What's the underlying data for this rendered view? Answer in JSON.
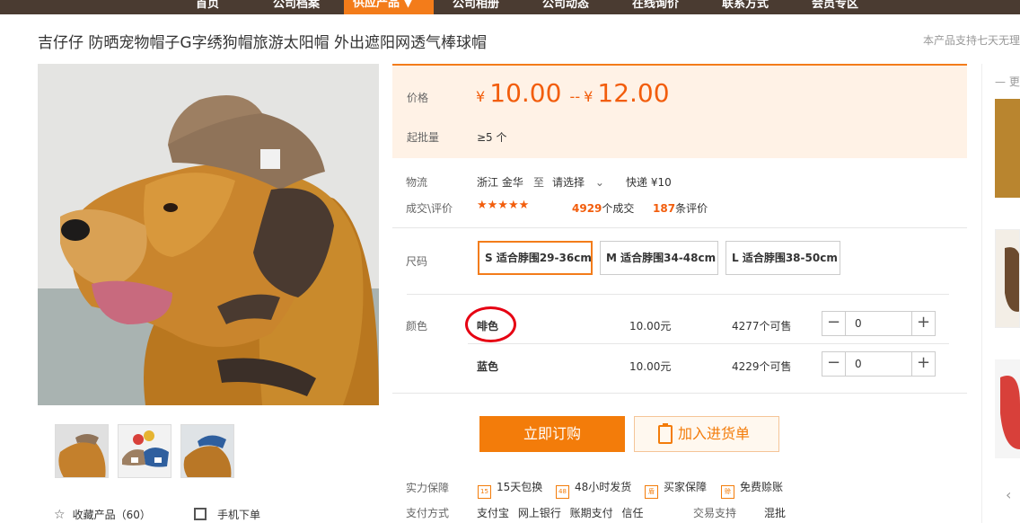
{
  "nav": {
    "items": [
      "首页",
      "公司档案",
      "供应产品 ▼",
      "公司相册",
      "公司动态",
      "在线询价",
      "联系方式",
      "会员专区"
    ]
  },
  "product": {
    "title": "吉仔仔 防晒宠物帽子G字绣狗帽旅游太阳帽 外出遮阳网透气棒球帽",
    "notice": "本产品支持七天无理"
  },
  "price": {
    "label": "价格",
    "currency": "¥",
    "low": "10.00",
    "separator": "--",
    "high": "12.00",
    "moq_label": "起批量",
    "moq_value": "≥5 个"
  },
  "logistics": {
    "label": "物流",
    "from": "浙江 金华",
    "to_word": "至",
    "select": "请选择",
    "express": "快递 ¥10"
  },
  "rating": {
    "label": "成交\\评价",
    "stars": "★★★★★",
    "deals_num": "4929",
    "deals_unit": "个成交",
    "reviews_num": "187",
    "reviews_unit": "条评价"
  },
  "size": {
    "label": "尺码",
    "options": [
      "S 适合脖围29-36cm",
      "M 适合脖围34-48cm",
      "L 适合脖围38-50cm"
    ],
    "selected_index": 0
  },
  "colors": {
    "label": "颜色",
    "rows": [
      {
        "name": "啡色",
        "price": "10.00元",
        "stock": "4277个可售",
        "qty": "0"
      },
      {
        "name": "蓝色",
        "price": "10.00元",
        "stock": "4229个可售",
        "qty": "0"
      }
    ]
  },
  "actions": {
    "buy": "立即订购",
    "cart": "加入进货单"
  },
  "guarantee": {
    "label": "实力保障",
    "items": [
      "15天包换",
      "48小时发货",
      "买家保障",
      "免费赊账"
    ],
    "icons": [
      "15",
      "48",
      "盾",
      "赊"
    ]
  },
  "payment": {
    "label": "支付方式",
    "items": "支付宝 网上银行 账期支付 信任",
    "trade_label": "交易支持",
    "trade_value": "混批"
  },
  "footer": {
    "favorite": "收藏产品（60）",
    "mobile": "手机下单"
  },
  "side": {
    "dash": "— 更"
  },
  "colors_theme": {
    "accent": "#f37c1a",
    "nav_bg": "#4a3b31",
    "price": "#f25d0c",
    "highlight": "#e60012"
  }
}
